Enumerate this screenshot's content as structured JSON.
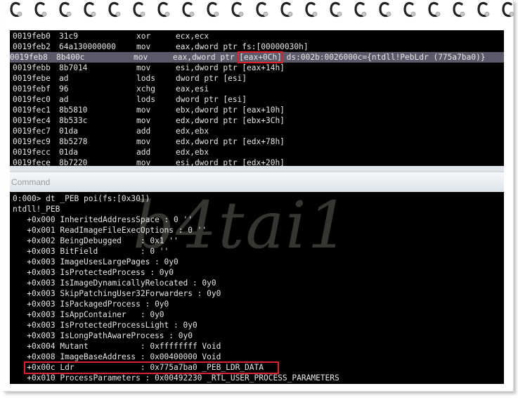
{
  "disassembly": {
    "lines": [
      {
        "addr": "0019feb0",
        "bytes": "31c9",
        "mnemonic": "xor",
        "operands": "ecx,ecx"
      },
      {
        "addr": "0019feb2",
        "bytes": "64a130000000",
        "mnemonic": "mov",
        "operands": "eax,dword ptr fs:[00000030h]"
      },
      {
        "addr": "0019feb8",
        "bytes": "8b400c",
        "mnemonic": "mov",
        "operands_pre": "eax,dword ptr ",
        "operands_box": "[eax+0Ch]",
        "operands_post": " ds:002b:0026000c={ntdll!PebLdr (775a7ba0)}"
      },
      {
        "addr": "0019febb",
        "bytes": "8b7014",
        "mnemonic": "mov",
        "operands": "esi,dword ptr [eax+14h]"
      },
      {
        "addr": "0019febe",
        "bytes": "ad",
        "mnemonic": "lods",
        "operands": "dword ptr [esi]"
      },
      {
        "addr": "0019febf",
        "bytes": "96",
        "mnemonic": "xchg",
        "operands": "eax,esi"
      },
      {
        "addr": "0019fec0",
        "bytes": "ad",
        "mnemonic": "lods",
        "operands": "dword ptr [esi]"
      },
      {
        "addr": "0019fec1",
        "bytes": "8b5810",
        "mnemonic": "mov",
        "operands": "ebx,dword ptr [eax+10h]"
      },
      {
        "addr": "0019fec4",
        "bytes": "8b533c",
        "mnemonic": "mov",
        "operands": "edx,dword ptr [ebx+3Ch]"
      },
      {
        "addr": "0019fec7",
        "bytes": "01da",
        "mnemonic": "add",
        "operands": "edx,ebx"
      },
      {
        "addr": "0019fec9",
        "bytes": "8b5278",
        "mnemonic": "mov",
        "operands": "edx,dword ptr [edx+78h]"
      },
      {
        "addr": "0019fecc",
        "bytes": "01da",
        "mnemonic": "add",
        "operands": "edx,ebx"
      },
      {
        "addr": "0019fece",
        "bytes": "8b7220",
        "mnemonic": "mov",
        "operands": "esi,dword ptr [edx+20h]"
      }
    ]
  },
  "command": {
    "title": "Command",
    "watermark": "b4tai1",
    "lines": [
      "0:000> dt _PEB poi(fs:[0x30])",
      "ntdll!_PEB",
      "   +0x000 InheritedAddressSpace : 0 ''",
      "   +0x001 ReadImageFileExecOptions : 0 ''",
      "   +0x002 BeingDebugged    : 0x1 ''",
      "   +0x003 BitField         : 0 ''",
      "   +0x003 ImageUsesLargePages : 0y0",
      "   +0x003 IsProtectedProcess : 0y0",
      "   +0x003 IsImageDynamicallyRelocated : 0y0",
      "   +0x003 SkipPatchingUser32Forwarders : 0y0",
      "   +0x003 IsPackagedProcess : 0y0",
      "   +0x003 IsAppContainer   : 0y0",
      "   +0x003 IsProtectedProcessLight : 0y0",
      "   +0x003 IsLongPathAwareProcess : 0y0",
      "   +0x004 Mutant           : 0xffffffff Void",
      "   +0x008 ImageBaseAddress : 0x00400000 Void",
      "   +0x00c Ldr              : 0x775a7ba0 _PEB_LDR_DATA",
      "   +0x010 ProcessParameters : 0x00492230 _RTL_USER_PROCESS_PARAMETERS"
    ]
  },
  "colors": {
    "highlight": "#5a5a6a",
    "annotation": "#e0202a",
    "background": "#000000",
    "text": "#e6e6e6"
  }
}
